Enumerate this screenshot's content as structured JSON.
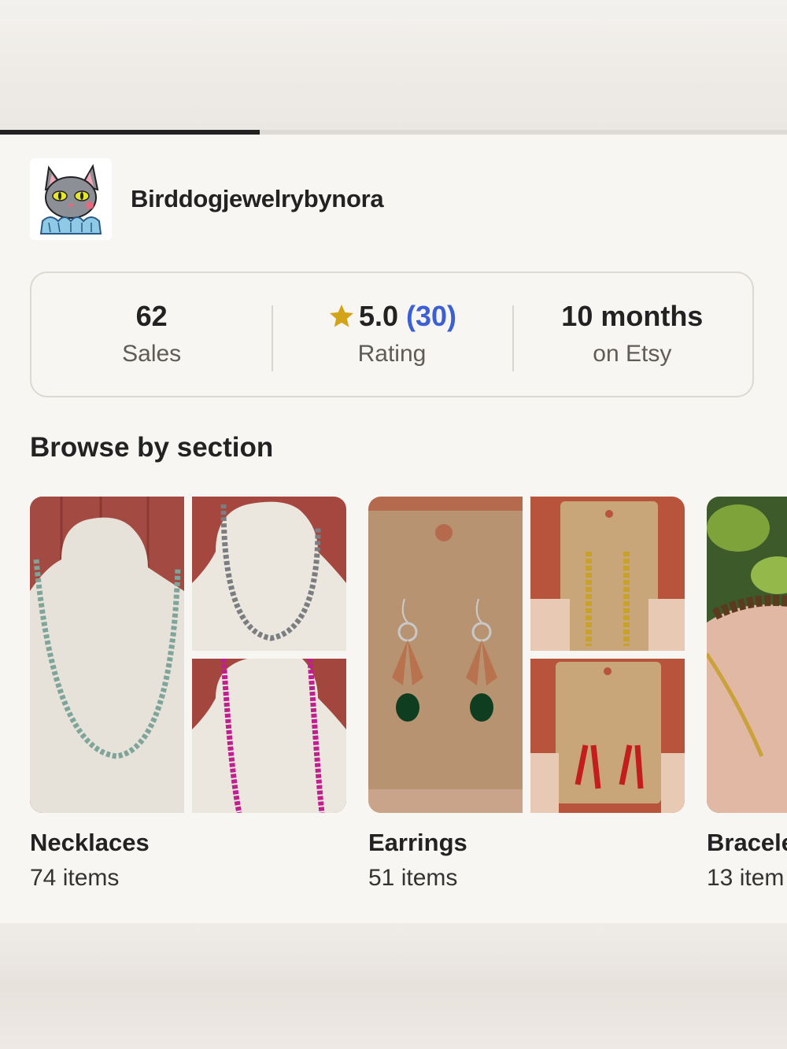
{
  "story": {
    "progress_percent": 33
  },
  "shop": {
    "name": "Birddogjewelrybynora"
  },
  "stats": [
    {
      "value": "62",
      "label": "Sales"
    },
    {
      "value": "5.0",
      "count": "(30)",
      "label": "Rating"
    },
    {
      "value": "10 months",
      "label": "on Etsy"
    }
  ],
  "browse": {
    "title": "Browse by section",
    "sections": [
      {
        "name": "Necklaces",
        "count": "74 items"
      },
      {
        "name": "Earrings",
        "count": "51 items"
      },
      {
        "name": "Bracele",
        "count": "13 item"
      }
    ]
  },
  "colors": {
    "accent_link": "#3b5fd6",
    "star": "#d4a418",
    "text": "#222222"
  }
}
